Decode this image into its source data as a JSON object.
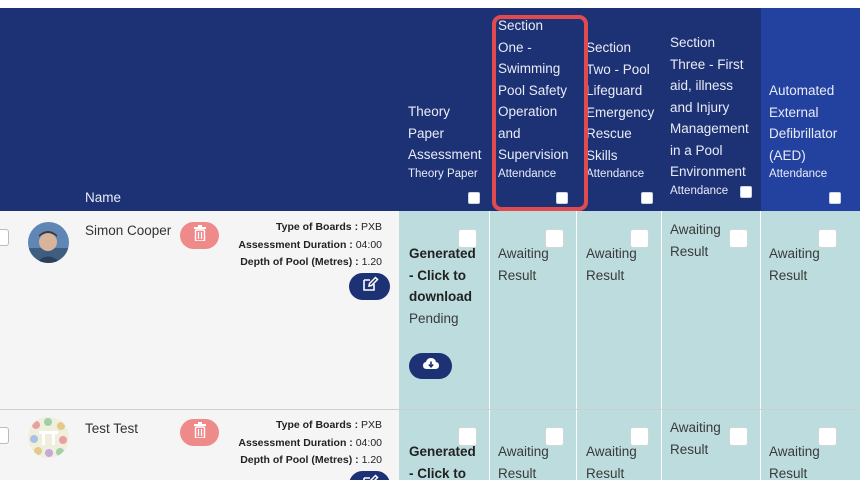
{
  "header": {
    "name_label": "Name",
    "columns": [
      {
        "title_lines": [
          "Theory",
          "Paper",
          "Assessment"
        ],
        "sub": "Theory Paper"
      },
      {
        "title_lines": [
          "Section",
          "One -",
          "Swimming",
          "Pool Safety",
          "Operation",
          "and",
          "Supervision"
        ],
        "sub": "Attendance"
      },
      {
        "title_lines": [
          "Section",
          "Two - Pool",
          "Lifeguard",
          "Emergency",
          "Rescue",
          "Skills"
        ],
        "sub": "Attendance"
      },
      {
        "title_lines": [
          "Section",
          "Three - First",
          "aid, illness",
          "and Injury",
          "Management",
          "in a Pool",
          "Environment"
        ],
        "sub": "Attendance"
      },
      {
        "title_lines": [
          "Automated",
          "External",
          "Defibrillator",
          "(AED)"
        ],
        "sub": "Attendance"
      }
    ]
  },
  "rows": [
    {
      "name": "Simon Cooper",
      "meta": [
        {
          "label": "Type of Boards :",
          "value": "PXB"
        },
        {
          "label": "Assessment Duration :",
          "value": "04:00"
        },
        {
          "label": "Depth of Pool (Metres) :",
          "value": "1.20"
        }
      ],
      "generated_lines": [
        "Generated",
        "- Click to",
        "download"
      ],
      "pending": "Pending",
      "awaiting": [
        "Awaiting",
        "Result"
      ]
    },
    {
      "name": "Test Test",
      "meta": [
        {
          "label": "Type of Boards :",
          "value": "PXB"
        },
        {
          "label": "Assessment Duration :",
          "value": "04:00"
        },
        {
          "label": "Depth of Pool (Metres) :",
          "value": "1.20"
        }
      ],
      "generated_lines": [
        "Generated",
        "- Click to"
      ],
      "awaiting": [
        "Awaiting",
        "Result"
      ]
    }
  ],
  "colors": {
    "header_bg": "#1d3175",
    "aed_header_bg": "#2342a0",
    "cell_bg": "#bcdcdd",
    "highlight": "#e14b50",
    "delete_button": "#ef8a8a"
  },
  "icons": {
    "delete": "trash-icon",
    "edit": "edit-icon",
    "download": "cloud-download-icon"
  }
}
